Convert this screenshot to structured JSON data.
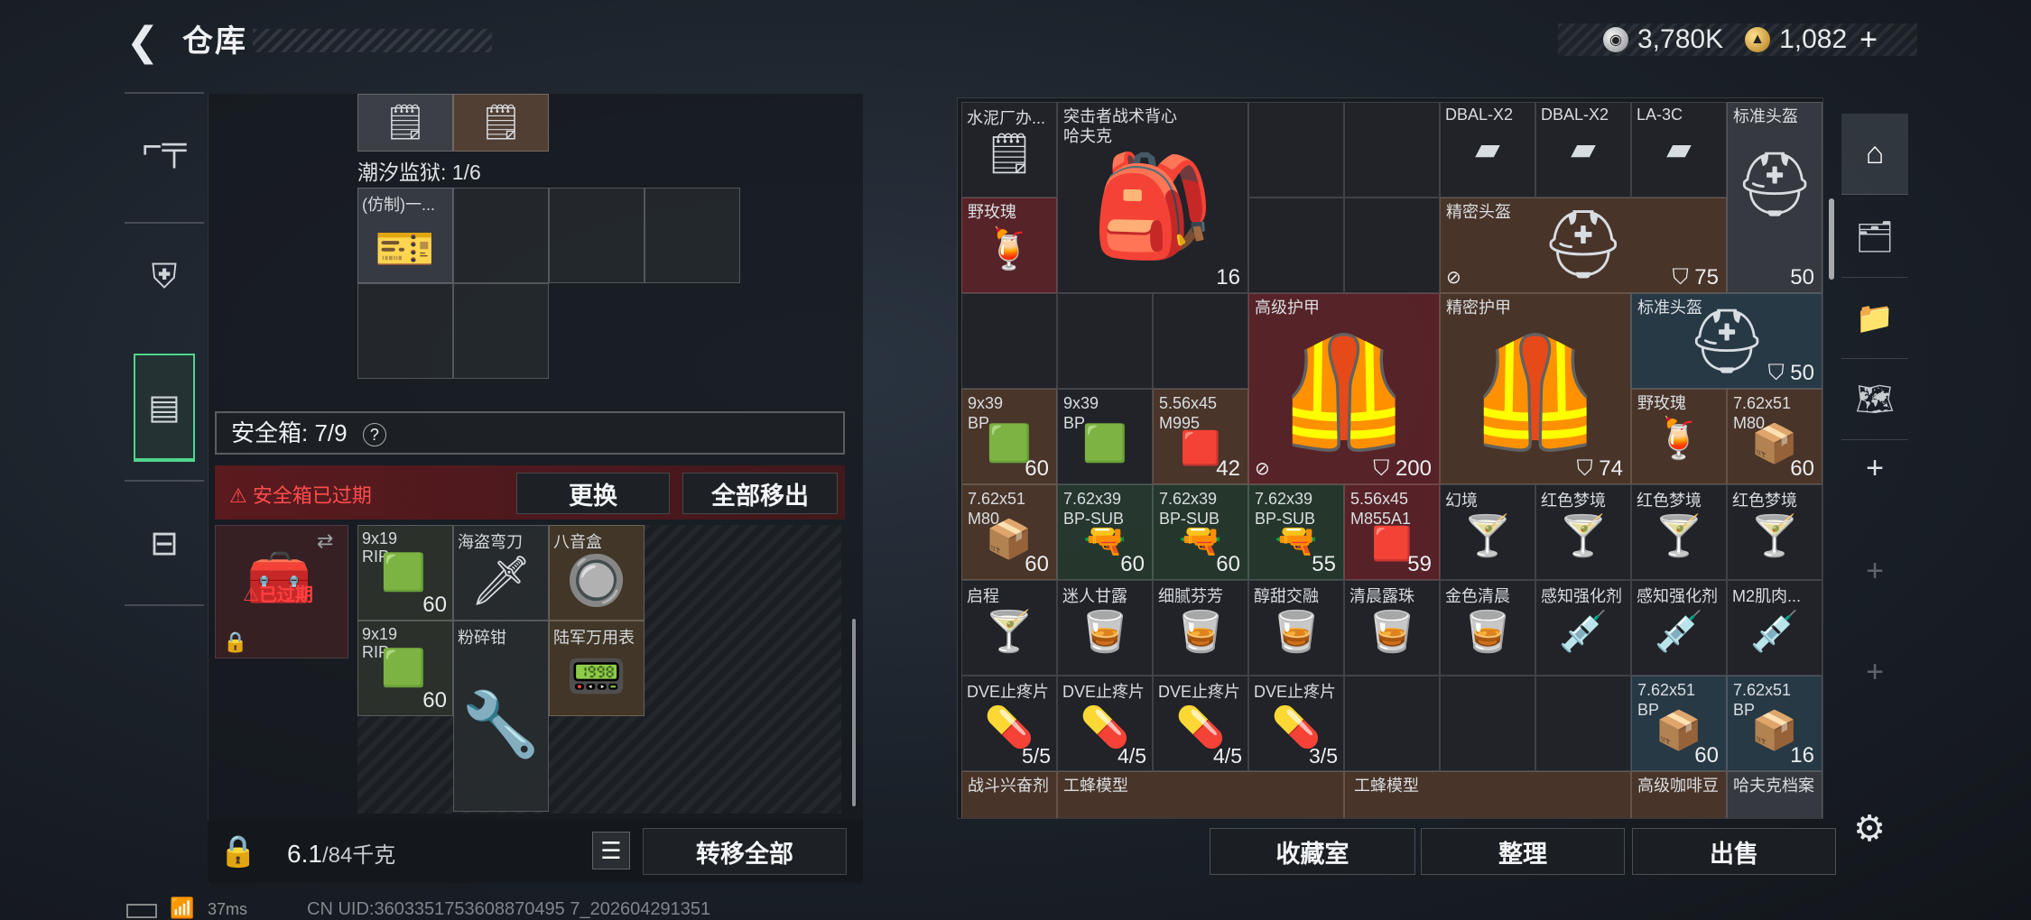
{
  "header": {
    "back_icon": "back-arrow-icon",
    "title": "仓库"
  },
  "currency": {
    "silver": "3,780K",
    "gold": "1,082",
    "plus": "+"
  },
  "left_nav": {
    "tabs": [
      {
        "icon": "pistol-icon",
        "glyph": "⌐"
      },
      {
        "icon": "backpack-icon",
        "glyph": "⛨"
      },
      {
        "icon": "container-icon",
        "glyph": "▣"
      },
      {
        "icon": "briefcase-icon",
        "glyph": "💼"
      }
    ]
  },
  "left_panel": {
    "tide_label": "潮汐监狱: 1/6",
    "fake_item": "(仿制)一...",
    "safe_label": "安全箱: 7/9",
    "safe_help": "?",
    "expired_text": "安全箱已过期",
    "replace_btn": "更换",
    "move_all_btn": "全部移出",
    "expired_badge": "已过期",
    "safe_items": [
      {
        "name": "9x19 RIP",
        "qty": "60"
      },
      {
        "name": "海盗弯刀",
        "qty": ""
      },
      {
        "name": "八音盒",
        "qty": ""
      },
      {
        "name": "9x19 RIP",
        "qty": "60"
      },
      {
        "name": "粉碎钳",
        "qty": ""
      },
      {
        "name": "陆军万用表",
        "qty": ""
      }
    ],
    "weight": "6.1",
    "weight_max": "/84千克",
    "transfer_all_btn": "转移全部"
  },
  "stash": {
    "items": [
      {
        "name": "水泥厂办...",
        "qty": ""
      },
      {
        "name": "突击者战术背心\n哈夫克",
        "qty": "16"
      },
      {
        "name": "DBAL-X2",
        "qty": ""
      },
      {
        "name": "DBAL-X2",
        "qty": ""
      },
      {
        "name": "LA-3C",
        "qty": ""
      },
      {
        "name": "标准头盔",
        "qty": "50"
      },
      {
        "name": "野玫瑰",
        "qty": ""
      },
      {
        "name": "精密头盔",
        "qty": "75"
      },
      {
        "name": "高级护甲",
        "qty": "200"
      },
      {
        "name": "精密护甲",
        "qty": "74"
      },
      {
        "name": "标准头盔",
        "qty": "50"
      },
      {
        "name": "9x39 BP",
        "qty": "60"
      },
      {
        "name": "9x39 BP",
        "qty": ""
      },
      {
        "name": "5.56x45 M995",
        "qty": "42"
      },
      {
        "name": "野玫瑰",
        "qty": ""
      },
      {
        "name": "7.62x51 M80",
        "qty": "60"
      },
      {
        "name": "7.62x51 M80",
        "qty": "60"
      },
      {
        "name": "7.62x39 BP-SUB",
        "qty": "60"
      },
      {
        "name": "7.62x39 BP-SUB",
        "qty": "60"
      },
      {
        "name": "7.62x39 BP-SUB",
        "qty": "55"
      },
      {
        "name": "5.56x45 M855A1",
        "qty": "59"
      },
      {
        "name": "幻境",
        "qty": ""
      },
      {
        "name": "红色梦境",
        "qty": ""
      },
      {
        "name": "红色梦境",
        "qty": ""
      },
      {
        "name": "红色梦境",
        "qty": ""
      },
      {
        "name": "启程",
        "qty": ""
      },
      {
        "name": "迷人甘露",
        "qty": ""
      },
      {
        "name": "细腻芬芳",
        "qty": ""
      },
      {
        "name": "醇甜交融",
        "qty": ""
      },
      {
        "name": "清晨露珠",
        "qty": ""
      },
      {
        "name": "金色清晨",
        "qty": ""
      },
      {
        "name": "感知强化剂",
        "qty": ""
      },
      {
        "name": "感知强化剂",
        "qty": ""
      },
      {
        "name": "M2肌肉...",
        "qty": ""
      },
      {
        "name": "DVE止疼片",
        "qty": "5/5"
      },
      {
        "name": "DVE止疼片",
        "qty": "4/5"
      },
      {
        "name": "DVE止疼片",
        "qty": "4/5"
      },
      {
        "name": "DVE止疼片",
        "qty": "3/5"
      },
      {
        "name": "7.62x51 BP",
        "qty": "60"
      },
      {
        "name": "7.62x51 BP",
        "qty": "16"
      },
      {
        "name": "战斗兴奋剂",
        "qty": ""
      },
      {
        "name": "工蜂模型",
        "qty": ""
      },
      {
        "name": "工蜂模型",
        "qty": ""
      },
      {
        "name": "高级咖啡豆",
        "qty": ""
      },
      {
        "name": "哈夫克档案",
        "qty": ""
      }
    ]
  },
  "bottom": {
    "collection_btn": "收藏室",
    "organize_btn": "整理",
    "sell_btn": "出售"
  },
  "status": {
    "ping": "37ms",
    "uid": "CN UID:3603351753608870495 7_202604291351"
  },
  "colors": {
    "accent_green": "#4fd68b",
    "alert_red": "#ff4d4d",
    "rare_red": "#62242a",
    "rare_gold": "#523a2c"
  }
}
